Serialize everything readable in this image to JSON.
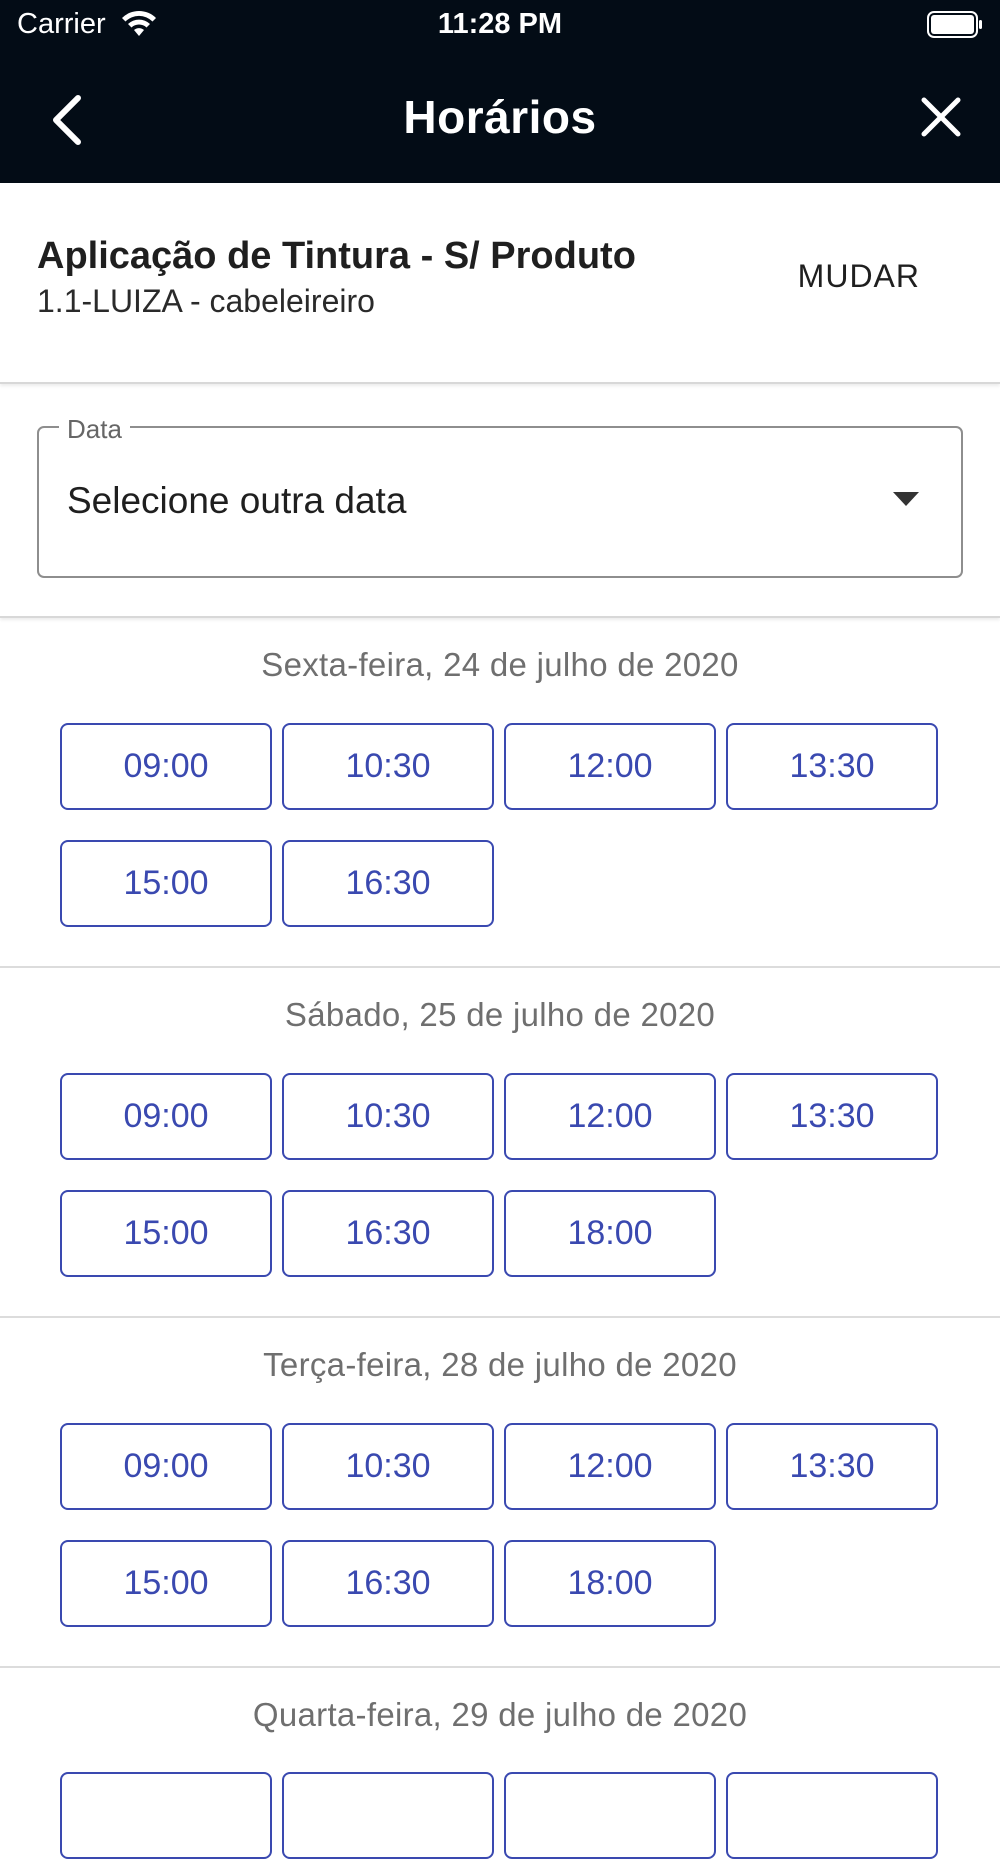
{
  "status": {
    "carrier": "Carrier",
    "time": "11:28 PM"
  },
  "nav": {
    "title": "Horários",
    "back_icon": "chevron-left-icon",
    "close_icon": "close-icon"
  },
  "service": {
    "name": "Aplicação de Tintura - S/ Produto",
    "professional": "1.1-LUIZA - cabeleireiro",
    "change_label": "MUDAR"
  },
  "date_field": {
    "label": "Data",
    "value": "Selecione outra data"
  },
  "days": [
    {
      "title": "Sexta-feira, 24 de julho de 2020",
      "slots": [
        "09:00",
        "10:30",
        "12:00",
        "13:30",
        "15:00",
        "16:30"
      ]
    },
    {
      "title": "Sábado, 25 de julho de 2020",
      "slots": [
        "09:00",
        "10:30",
        "12:00",
        "13:30",
        "15:00",
        "16:30",
        "18:00"
      ]
    },
    {
      "title": "Terça-feira, 28 de julho de 2020",
      "slots": [
        "09:00",
        "10:30",
        "12:00",
        "13:30",
        "15:00",
        "16:30",
        "18:00"
      ]
    },
    {
      "title": "Quarta-feira, 29 de julho de 2020",
      "slots": []
    }
  ],
  "colors": {
    "header": "#030c16",
    "accent": "#3a49b0"
  }
}
